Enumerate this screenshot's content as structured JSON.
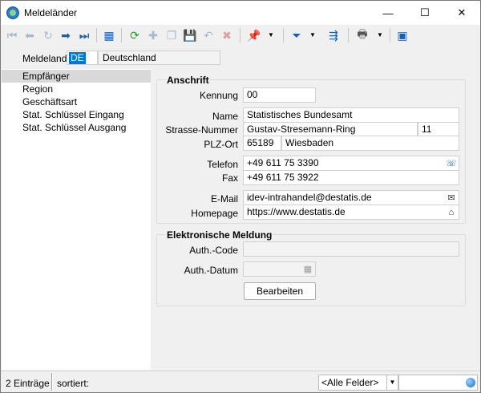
{
  "window": {
    "title": "Meldeländer",
    "minimize": "—",
    "maximize": "☐",
    "close": "✕"
  },
  "toolbar": {
    "icons": {
      "first": "⏮",
      "prev": "⬅",
      "refresh_dis": "↻",
      "next": "➡",
      "last": "⏭",
      "table": "▦",
      "sync": "⟳",
      "new": "✚",
      "copy": "❐",
      "save": "💾",
      "undo": "↶",
      "delete": "✖",
      "pin": "📌",
      "filter": "⏷",
      "go": "⇶",
      "print": "🖶",
      "export": "▣",
      "dropdown": "▼"
    }
  },
  "meldeland": {
    "label": "Meldeland",
    "code": "DE",
    "name": "Deutschland"
  },
  "nav": {
    "items": [
      {
        "label": "Empfänger"
      },
      {
        "label": "Region"
      },
      {
        "label": "Geschäftsart"
      },
      {
        "label": "Stat. Schlüssel Eingang"
      },
      {
        "label": "Stat. Schlüssel Ausgang"
      }
    ]
  },
  "anschrift": {
    "title": "Anschrift",
    "kennung_label": "Kennung",
    "kennung": "00",
    "name_label": "Name",
    "name": "Statistisches Bundesamt",
    "strasse_label": "Strasse-Nummer",
    "strasse": "Gustav-Stresemann-Ring",
    "nummer": "11",
    "plz_label": "PLZ-Ort",
    "plz": "65189",
    "ort": "Wiesbaden",
    "telefon_label": "Telefon",
    "telefon": "+49 611 75 3390",
    "fax_label": "Fax",
    "fax": "+49 611 75 3922",
    "email_label": "E-Mail",
    "email": "idev-intrahandel@destatis.de",
    "homepage_label": "Homepage",
    "homepage": "https://www.destatis.de"
  },
  "meldung": {
    "title": "Elektronische Meldung",
    "authcode_label": "Auth.-Code",
    "authcode": "",
    "authdatum_label": "Auth.-Datum",
    "authdatum": "",
    "bearbeiten": "Bearbeiten"
  },
  "status": {
    "count": "2 Einträge",
    "sorted": "sortiert:",
    "field_select": "<Alle Felder>",
    "search_value": ""
  },
  "colors": {
    "accent": "#0078d7",
    "nav_selected": "#d9d9d9"
  }
}
